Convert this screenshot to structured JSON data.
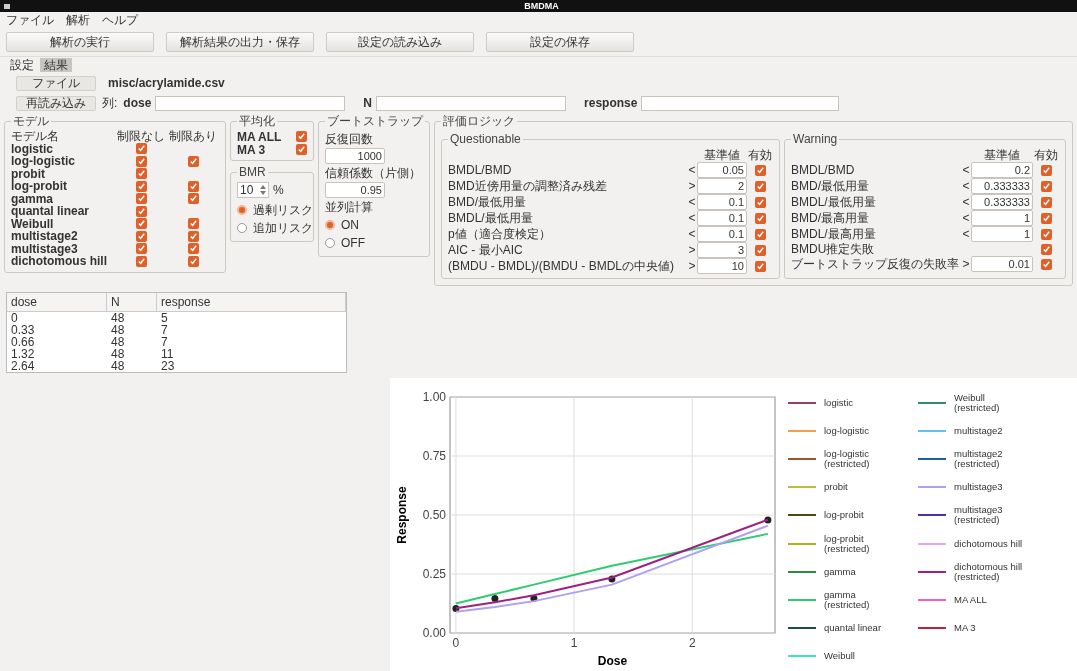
{
  "window": {
    "title": "BMDMA"
  },
  "menu": [
    {
      "label": "ファイル"
    },
    {
      "label": "解析"
    },
    {
      "label": "ヘルプ"
    }
  ],
  "toolbar": [
    "解析の実行",
    "解析結果の出力・保存",
    "設定の読み込み",
    "設定の保存"
  ],
  "tabs": [
    {
      "label": "設定",
      "selected": false
    },
    {
      "label": "結果",
      "selected": true
    }
  ],
  "file": {
    "button": "ファイル",
    "path": "misc/acrylamide.csv"
  },
  "columns": {
    "reload": "再読み込み",
    "label": "列:",
    "fields": [
      {
        "label": "dose"
      },
      {
        "label": "N"
      },
      {
        "label": "response"
      }
    ]
  },
  "models": {
    "title": "モデル",
    "headers": [
      "モデル名",
      "制限なし",
      "制限あり"
    ],
    "rows": [
      {
        "name": "logistic",
        "unrestricted": true
      },
      {
        "name": "log-logistic",
        "unrestricted": true,
        "restricted": true
      },
      {
        "name": "probit",
        "unrestricted": true
      },
      {
        "name": "log-probit",
        "unrestricted": true,
        "restricted": true
      },
      {
        "name": "gamma",
        "unrestricted": true,
        "restricted": true
      },
      {
        "name": "quantal linear",
        "unrestricted": true
      },
      {
        "name": "Weibull",
        "unrestricted": true,
        "restricted": true
      },
      {
        "name": "multistage2",
        "unrestricted": true,
        "restricted": true
      },
      {
        "name": "multistage3",
        "unrestricted": true,
        "restricted": true
      },
      {
        "name": "dichotomous hill",
        "unrestricted": true,
        "restricted": true
      }
    ]
  },
  "averaging": {
    "title": "平均化",
    "items": [
      {
        "label": "MA ALL",
        "checked": true
      },
      {
        "label": "MA 3",
        "checked": true
      }
    ]
  },
  "bmr": {
    "title": "BMR",
    "value": "10",
    "unit": "%",
    "options": [
      {
        "label": "過剰リスク",
        "selected": true
      },
      {
        "label": "追加リスク",
        "selected": false
      }
    ]
  },
  "bootstrap": {
    "title": "ブートストラップ",
    "fields": [
      {
        "label": "反復回数",
        "value": "1000"
      },
      {
        "label": "信頼係数（片側）",
        "value": "0.95"
      }
    ],
    "parallel": {
      "label": "並列計算",
      "options": [
        {
          "label": "ON",
          "selected": true
        },
        {
          "label": "OFF",
          "selected": false
        }
      ]
    }
  },
  "evaluation": {
    "title": "評価ロジック",
    "groups": [
      {
        "title": "Questionable",
        "headers": [
          "基準値",
          "有効"
        ],
        "rows": [
          {
            "label": "BMDL/BMD",
            "op": "<",
            "value": "0.05",
            "enabled": true
          },
          {
            "label": "BMD近傍用量の調整済み残差",
            "op": ">",
            "value": "2",
            "enabled": true
          },
          {
            "label": "BMD/最低用量",
            "op": "<",
            "value": "0.1",
            "enabled": true
          },
          {
            "label": "BMDL/最低用量",
            "op": "<",
            "value": "0.1",
            "enabled": true
          },
          {
            "label": "p値（適合度検定）",
            "op": "<",
            "value": "0.1",
            "enabled": true
          },
          {
            "label": "AIC - 最小AIC",
            "op": ">",
            "value": "3",
            "enabled": true
          },
          {
            "label": "(BMDU - BMDL)/(BMDU - BMDLの中央値)",
            "op": ">",
            "value": "10",
            "enabled": true
          }
        ]
      },
      {
        "title": "Warning",
        "headers": [
          "基準値",
          "有効"
        ],
        "rows": [
          {
            "label": "BMDL/BMD",
            "op": "<",
            "value": "0.2",
            "enabled": true
          },
          {
            "label": "BMD/最低用量",
            "op": "<",
            "value": "0.333333",
            "enabled": true
          },
          {
            "label": "BMDL/最低用量",
            "op": "<",
            "value": "0.333333",
            "enabled": true
          },
          {
            "label": "BMD/最高用量",
            "op": "<",
            "value": "1",
            "enabled": true
          },
          {
            "label": "BMDL/最高用量",
            "op": "<",
            "value": "1",
            "enabled": true
          },
          {
            "label": "BMDU推定失敗",
            "enabled": true
          },
          {
            "label": "ブートストラップ反復の失敗率",
            "op": ">",
            "value": "0.01",
            "enabled": true
          }
        ]
      }
    ]
  },
  "data_table": {
    "columns": [
      "dose",
      "N",
      "response"
    ],
    "rows": [
      [
        "0",
        "48",
        "5"
      ],
      [
        "0.33",
        "48",
        "7"
      ],
      [
        "0.66",
        "48",
        "7"
      ],
      [
        "1.32",
        "48",
        "11"
      ],
      [
        "2.64",
        "48",
        "23"
      ]
    ]
  },
  "chart": {
    "chart_data": {
      "type": "line",
      "xlabel": "Dose",
      "ylabel": "Response",
      "x": [
        0,
        0.33,
        0.66,
        1.32,
        2.64
      ],
      "xlim": [
        -0.05,
        2.7
      ],
      "ylim": [
        0,
        1
      ],
      "xticks": [
        {
          "value": 0,
          "label": "0"
        },
        {
          "value": 1,
          "label": "1"
        },
        {
          "value": 2,
          "label": "2"
        }
      ],
      "yticks": [
        {
          "value": 0,
          "label": "0.00"
        },
        {
          "value": 0.25,
          "label": "0.25"
        },
        {
          "value": 0.5,
          "label": "0.50"
        },
        {
          "value": 0.75,
          "label": "0.75"
        },
        {
          "value": 1,
          "label": "1.00"
        }
      ],
      "series": [
        {
          "type": "scatter",
          "color": "#222222",
          "values": [
            0.104,
            0.146,
            0.146,
            0.229,
            0.479
          ]
        },
        {
          "name": "logistic",
          "color": "#9b3d6b",
          "values": [
            null,
            null,
            null,
            null,
            null
          ]
        },
        {
          "name": "log-logistic",
          "color": "#f0a050",
          "values": [
            null,
            null,
            null,
            null,
            null
          ]
        },
        {
          "name": "log-logistic\n(restricted)",
          "color": "#a0522d",
          "values": [
            null,
            null,
            null,
            null,
            null
          ]
        },
        {
          "name": "probit",
          "color": "#b8c040",
          "values": [
            null,
            null,
            null,
            null,
            null
          ]
        },
        {
          "name": "log-probit",
          "color": "#4a4a10",
          "values": [
            null,
            null,
            null,
            null,
            null
          ]
        },
        {
          "name": "log-probit\n(restricted)",
          "color": "#b0b020",
          "values": [
            null,
            null,
            null,
            null,
            null
          ]
        },
        {
          "name": "gamma",
          "color": "#2e8b3e",
          "values": [
            null,
            null,
            null,
            null,
            null
          ]
        },
        {
          "name": "gamma\n(restricted)",
          "color": "#2ecc71",
          "values": [
            0.125,
            0.165,
            0.205,
            0.285,
            0.42
          ]
        },
        {
          "name": "quantal linear",
          "color": "#1f4f3f",
          "values": [
            null,
            null,
            null,
            null,
            null
          ]
        },
        {
          "name": "Weibull",
          "color": "#40e0c0",
          "values": [
            null,
            null,
            null,
            null,
            null
          ]
        },
        {
          "name": "Weibull\n(restricted)",
          "color": "#2e8b6e",
          "values": [
            null,
            null,
            null,
            null,
            null
          ]
        },
        {
          "name": "multistage2",
          "color": "#60c0f0",
          "values": [
            null,
            null,
            null,
            null,
            null
          ]
        },
        {
          "name": "multistage2\n(restricted)",
          "color": "#2060a0",
          "values": [
            null,
            null,
            null,
            null,
            null
          ]
        },
        {
          "name": "multistage3",
          "color": "#b0a0f0",
          "values": [
            0.09,
            0.11,
            0.135,
            0.205,
            0.455
          ]
        },
        {
          "name": "multistage3\n(restricted)",
          "color": "#5030a0",
          "values": [
            null,
            null,
            null,
            null,
            null
          ]
        },
        {
          "name": "dichotomous hill",
          "color": "#f0a0f0",
          "values": [
            null,
            null,
            null,
            null,
            null
          ]
        },
        {
          "name": "dichotomous hill\n(restricted)",
          "color": "#a02080",
          "values": [
            0.105,
            0.13,
            0.16,
            0.235,
            0.48
          ]
        },
        {
          "name": "MA ALL",
          "color": "#f060c0",
          "values": [
            null,
            null,
            null,
            null,
            null
          ]
        },
        {
          "name": "MA 3",
          "color": "#c02040",
          "values": [
            null,
            null,
            null,
            null,
            null
          ]
        }
      ],
      "grid": true,
      "legend": true
    }
  }
}
